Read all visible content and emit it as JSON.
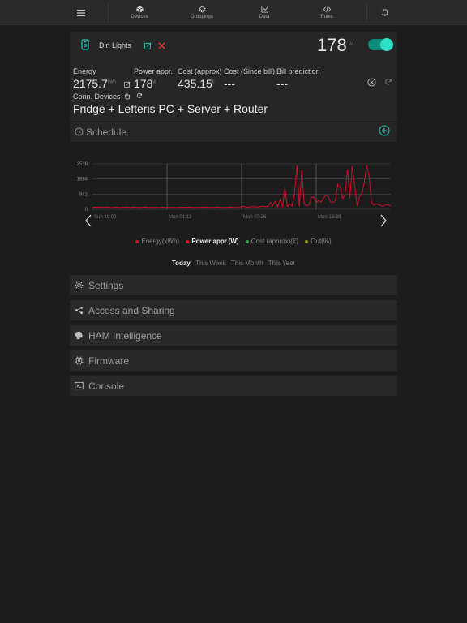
{
  "nav": {
    "items": [
      {
        "label": "Devices",
        "icon": "cube-icon"
      },
      {
        "label": "Groupings",
        "icon": "layers-icon"
      },
      {
        "label": "Data",
        "icon": "line-chart-icon"
      },
      {
        "label": "Rules",
        "icon": "code-icon"
      }
    ],
    "menu_icon": "hamburger-menu-icon",
    "bell_icon": "bell-icon"
  },
  "device": {
    "name": "Din Lights",
    "power_value": "178",
    "power_unit": "W",
    "enabled": true,
    "metrics": [
      {
        "header": "Energy",
        "value": "2175.7",
        "unit": "kWh"
      },
      {
        "header": "Power appr.",
        "value": "178",
        "unit": "W"
      },
      {
        "header": "Cost (approx)",
        "value": "435.15",
        "unit": "€"
      },
      {
        "header": "Cost (Since bill)",
        "value": "---",
        "unit": ""
      },
      {
        "header": "Bill prediction",
        "value": "---",
        "unit": ""
      }
    ],
    "conn_label": "Conn. Devices",
    "connected_devices": "Fridge + Lefteris PC + Server + Router"
  },
  "schedule": {
    "title": "Schedule"
  },
  "chart_data": {
    "type": "line",
    "y_ticks": [
      "2526",
      "1684",
      "842",
      "0"
    ],
    "x_ticks": [
      "Sun 19:00",
      "Mon 01:13",
      "Mon 07:26",
      "Mon 13:39"
    ],
    "ylim": [
      0,
      2526
    ],
    "series": [
      {
        "name": "Power appr.(W)",
        "color": "#d0102a",
        "values": [
          90,
          120,
          100,
          130,
          95,
          110,
          140,
          100,
          90,
          105,
          120,
          95,
          100,
          110,
          130,
          100,
          95,
          120,
          110,
          100,
          90,
          115,
          120,
          100,
          95,
          105,
          110,
          100,
          95,
          120,
          100,
          90,
          110,
          105,
          100,
          95,
          100,
          115,
          110,
          100,
          120,
          105,
          100,
          95,
          110,
          100,
          130,
          110,
          100,
          105,
          95,
          110,
          120,
          100,
          95,
          105,
          100,
          120,
          110,
          100,
          95,
          110,
          140,
          160,
          130,
          110,
          150,
          140,
          130,
          120,
          150,
          170,
          140,
          160,
          380,
          200,
          450,
          150,
          560,
          120,
          1200,
          150,
          300,
          180,
          900,
          2450,
          160,
          2200,
          300,
          200,
          250,
          650,
          700,
          350,
          500,
          400,
          600,
          800,
          700,
          420,
          380,
          500,
          1400,
          1200,
          600,
          800,
          2200,
          600,
          2400,
          1300,
          200,
          700,
          900,
          1500,
          2450,
          1800,
          350,
          250,
          300,
          260,
          200,
          180,
          260,
          240,
          200
        ]
      }
    ],
    "legend": [
      {
        "label": "Energy(kWh)",
        "color": "#d0102a",
        "active": false
      },
      {
        "label": "Power appr.(W)",
        "color": "#e01030",
        "active": true
      },
      {
        "label": "Cost (approx)(€)",
        "color": "#3a9a5a",
        "active": false
      },
      {
        "label": "Out(%)",
        "color": "#9a9a20",
        "active": false
      }
    ]
  },
  "periods": [
    {
      "label": "Today",
      "selected": true
    },
    {
      "label": "This Week",
      "selected": false
    },
    {
      "label": "This Month",
      "selected": false
    },
    {
      "label": "This Year",
      "selected": false
    }
  ],
  "sections": [
    {
      "title": "Settings",
      "icon": "gear-icon"
    },
    {
      "title": "Access and Sharing",
      "icon": "share-icon"
    },
    {
      "title": "HAM Intelligence",
      "icon": "brain-icon"
    },
    {
      "title": "Firmware",
      "icon": "chip-icon"
    },
    {
      "title": "Console",
      "icon": "terminal-icon"
    }
  ]
}
